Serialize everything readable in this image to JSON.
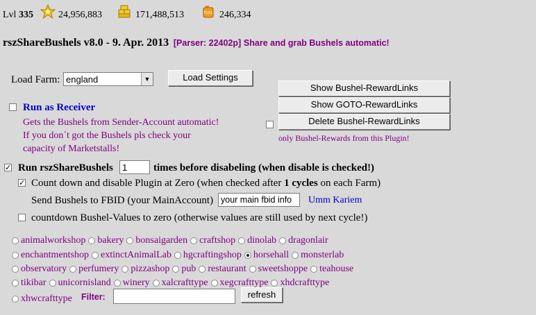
{
  "stats": {
    "level_label": "Lvl",
    "level": "335",
    "coins": "24,956,883",
    "gold": "171,488,513",
    "fuel": "246,334"
  },
  "header": {
    "title": "rszShareBushels v8.0 - 9. Apr. 2013",
    "parser": "[Parser: 22402p]",
    "tagline": "Share and grab Bushels automatic!"
  },
  "load_farm": {
    "label": "Load Farm:",
    "selected": "england",
    "button": "Load Settings"
  },
  "receiver": {
    "checkbox_label": "Run as Receiver",
    "help_lines": [
      "Gets the Bushels from Sender-Account automatic!",
      "If you don´t got the Bushels pls check your",
      "capacity of Marketstalls!"
    ]
  },
  "reward_buttons": {
    "show_bushel": "Show Bushel-RewardLinks",
    "show_goto": "Show GOTO-RewardLinks",
    "delete_bushel": "Delete Bushel-RewardLinks",
    "only_plugin_label": "only Bushel-Rewards from this Plugin!"
  },
  "run_settings": {
    "run_label": "Run rszShareBushels",
    "times_value": "1",
    "times_suffix": "times before disabeling (when disable is checked!)",
    "countdown_pre": "Count down and disable Plugin at Zero (when checked after",
    "countdown_num": "1 cycles",
    "countdown_post": "on each Farm)",
    "send_label": "Send Bushels to FBID (your MainAccount)",
    "fbid_value": "your main fbid info",
    "fbid_name": "Umm Kariem",
    "reset_label": "countdown Bushel-Values to zero (otherwise values are still used by next cycle!)"
  },
  "farm_types": [
    [
      "animalworkshop",
      "bakery",
      "bonsaigarden",
      "craftshop",
      "dinolab",
      "dragonlair"
    ],
    [
      "enchantmentshop",
      "extinctAnimalLab",
      "hgcraftingshop",
      "horsehall",
      "monsterlab"
    ],
    [
      "observatory",
      "perfumery",
      "pizzashop",
      "pub",
      "restaurant",
      "sweetshoppe",
      "teahouse"
    ],
    [
      "tikibar",
      "unicornisland",
      "winery",
      "xalcrafttype",
      "xegcrafttype",
      "xhdcrafttype"
    ],
    [
      "xhwcrafttype"
    ]
  ],
  "selected_farm_type": "horsehall",
  "filter": {
    "label": "Filter:",
    "value": "",
    "refresh": "refresh"
  },
  "icons": {
    "coins": "star-coin-icon",
    "gold": "gold-bars-icon",
    "fuel": "fuel-can-icon"
  }
}
